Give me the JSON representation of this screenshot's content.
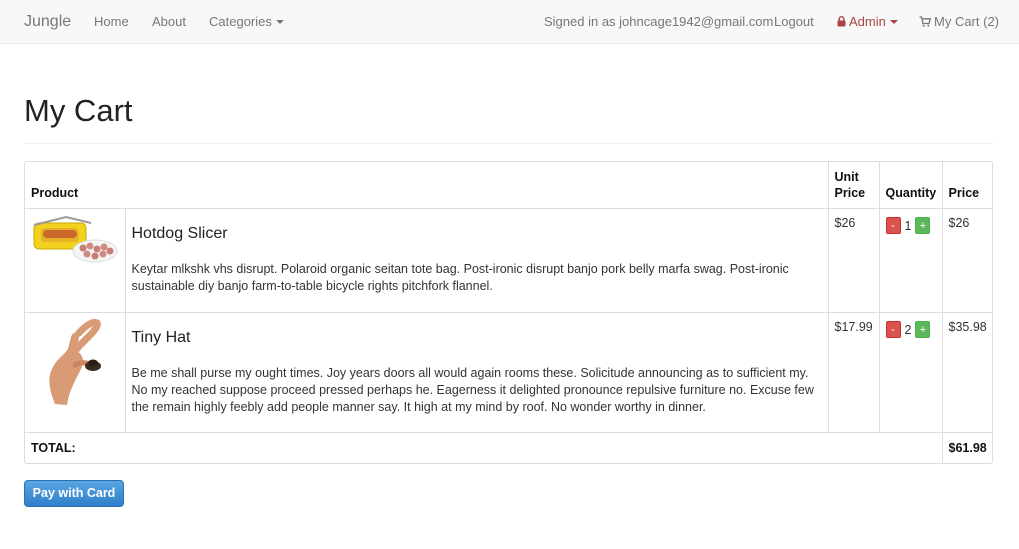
{
  "navbar": {
    "brand": "Jungle",
    "home": "Home",
    "about": "About",
    "categories": "Categories",
    "signed_in": "Signed in as johncage1942@gmail.com",
    "logout": "Logout",
    "admin": "Admin",
    "cart": "My Cart (2)"
  },
  "page": {
    "title": "My Cart"
  },
  "table": {
    "headers": {
      "product": "Product",
      "unit_price": "Unit Price",
      "quantity": "Quantity",
      "price": "Price"
    },
    "rows": [
      {
        "name": "Hotdog Slicer",
        "description": "Keytar mlkshk vhs disrupt. Polaroid organic seitan tote bag. Post-ironic disrupt banjo pork belly marfa swag. Post-ironic sustainable diy banjo farm-to-table bicycle rights pitchfork flannel.",
        "unit_price": "$26",
        "quantity": "1",
        "price": "$26",
        "image_icon": "hotdog-slicer-image"
      },
      {
        "name": "Tiny Hat",
        "description": "Be me shall purse my ought times. Joy years doors all would again rooms these. Solicitude announcing as to sufficient my. No my reached suppose proceed pressed perhaps he. Eagerness it delighted pronounce repulsive furniture no. Excuse few the remain highly feebly add people manner say. It high at my mind by roof. No wonder worthy in dinner.",
        "unit_price": "$17.99",
        "quantity": "2",
        "price": "$35.98",
        "image_icon": "tiny-hat-image"
      }
    ],
    "minus_label": "-",
    "plus_label": "+",
    "total_label": "TOTAL:",
    "total_value": "$61.98"
  },
  "actions": {
    "pay_label": "Pay with Card"
  },
  "colors": {
    "navbar_bg": "#f8f8f8",
    "admin": "#a94442",
    "minus": "#d9534f",
    "plus": "#5cb85c",
    "pay_button": "#3a8ed6"
  }
}
